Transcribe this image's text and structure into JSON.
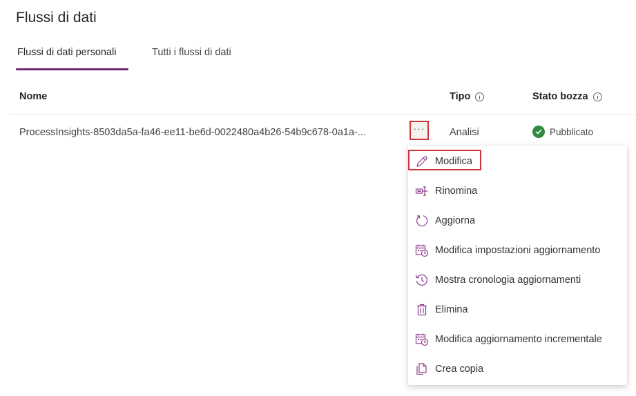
{
  "page": {
    "title": "Flussi di dati"
  },
  "tabs": [
    {
      "label": "Flussi di dati personali",
      "active": true
    },
    {
      "label": "Tutti i flussi di dati",
      "active": false
    }
  ],
  "table": {
    "columns": {
      "name": "Nome",
      "type": "Tipo",
      "draft_status": "Stato bozza"
    },
    "rows": [
      {
        "name": "ProcessInsights-8503da5a-fa46-ee11-be6d-0022480a4b26-54b9c678-0a1a-...",
        "more": "···",
        "type": "Analisi",
        "status": "Pubblicato"
      }
    ]
  },
  "context_menu": {
    "items": [
      {
        "label": "Modifica",
        "icon": "pencil-icon"
      },
      {
        "label": "Rinomina",
        "icon": "rename-icon"
      },
      {
        "label": "Aggiorna",
        "icon": "refresh-icon"
      },
      {
        "label": "Modifica impostazioni aggiornamento",
        "icon": "calendar-clock-icon"
      },
      {
        "label": "Mostra cronologia aggiornamenti",
        "icon": "history-icon"
      },
      {
        "label": "Elimina",
        "icon": "trash-icon"
      },
      {
        "label": "Modifica aggiornamento incrementale",
        "icon": "calendar-clock-icon"
      },
      {
        "label": "Crea copia",
        "icon": "copy-icon"
      }
    ]
  },
  "colors": {
    "accent": "#742774",
    "highlight": "#d13438",
    "success": "#2e8b3e",
    "menu_icon": "#8a3d8c"
  }
}
